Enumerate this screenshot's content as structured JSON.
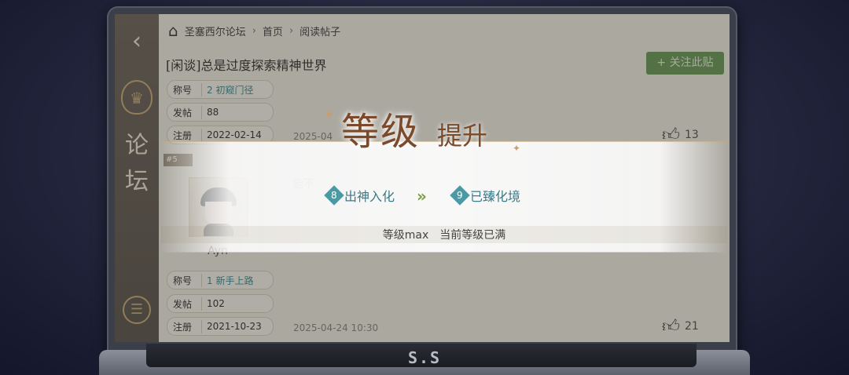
{
  "header": {
    "breadcrumb": [
      "圣塞西尔论坛",
      "首页",
      "阅读帖子"
    ],
    "title": "[闲谈]总是过度探索精神世界",
    "follow_label": "关注此贴"
  },
  "sidebar": {
    "back_icon": "chevron-left-icon",
    "emblem_icon": "crown-shield-icon",
    "label_chars": [
      "论",
      "坛"
    ],
    "menu_icon": "list-icon"
  },
  "posts": [
    {
      "title_key": "称号",
      "title_badge_num": "2",
      "title_badge": "初窥门径",
      "posts_key": "发帖",
      "posts_val": "88",
      "reg_key": "注册",
      "reg_val": "2022-02-14",
      "time": "2025-04",
      "likes": "13"
    },
    {
      "floor": "#5",
      "username": "Ayn",
      "snippet": "能不",
      "title_key": "称号",
      "title_badge_num": "1",
      "title_badge": "新手上路",
      "posts_key": "发帖",
      "posts_val": "102",
      "reg_key": "注册",
      "reg_val": "2021-10-23",
      "time": "2025-04-24  10:30",
      "likes": "21"
    }
  ],
  "levelup": {
    "title_a": "等级",
    "title_b": "提升",
    "from_num": "8",
    "from_name": "出神入化",
    "to_num": "9",
    "to_name": "已臻化境",
    "max_text": "等级max　当前等级已满"
  },
  "device": {
    "brand": "S.S"
  },
  "colors": {
    "accent_green": "#6b9a5a",
    "level_teal": "#4a9aa6",
    "title_brown": "#7a4a2a"
  }
}
